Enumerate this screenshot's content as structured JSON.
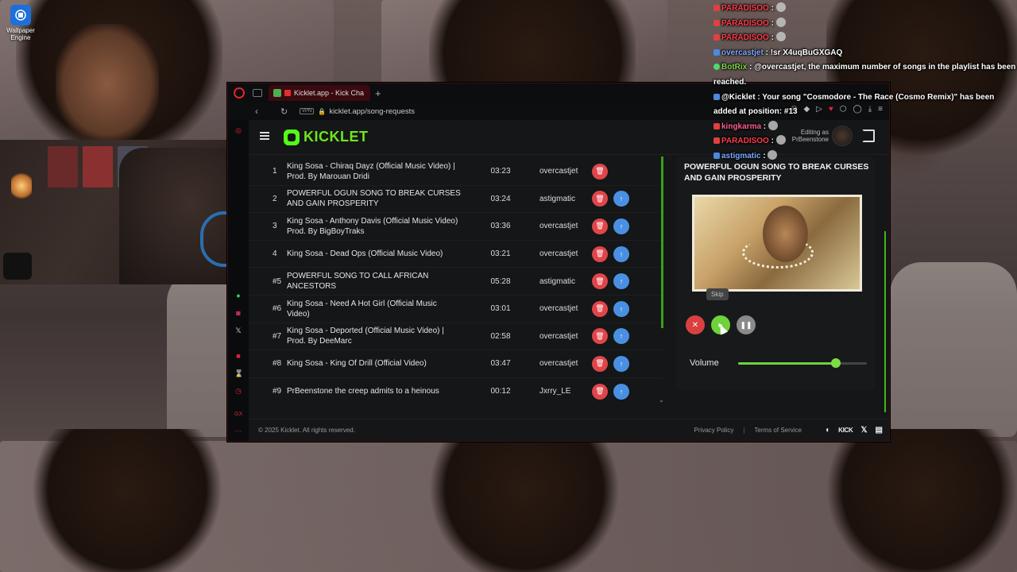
{
  "desktop": {
    "icon_label": "Wallpaper Engine"
  },
  "browser": {
    "tab_title": "Kicklet.app - Kick Cha",
    "vpn_badge": "VPN",
    "url": "kicklet.app/song-requests"
  },
  "app": {
    "logo_text": "KICKLET",
    "editing_as": "Editing as",
    "editing_user": "PrBeenstone"
  },
  "queue": [
    {
      "num": "1",
      "title": "King Sosa - Chiraq Dayz (Official Music Video) | Prod. By Marouan Dridi",
      "duration": "03:23",
      "user": "overcastjet",
      "can_move_up": false
    },
    {
      "num": "2",
      "title": "POWERFUL OGUN SONG TO BREAK CURSES AND GAIN PROSPERITY",
      "duration": "03:24",
      "user": "astigmatic",
      "can_move_up": true
    },
    {
      "num": "3",
      "title": "King Sosa - Anthony Davis (Official Music Video) Prod. By BigBoyTraks",
      "duration": "03:36",
      "user": "overcastjet",
      "can_move_up": true
    },
    {
      "num": "4",
      "title": "King Sosa - Dead Ops (Official Music Video)",
      "duration": "03:21",
      "user": "overcastjet",
      "can_move_up": true
    },
    {
      "num": "#5",
      "title": "POWERFUL SONG TO CALL AFRICAN ANCESTORS",
      "duration": "05:28",
      "user": "astigmatic",
      "can_move_up": true
    },
    {
      "num": "#6",
      "title": "King Sosa - Need A Hot Girl (Official Music Video)",
      "duration": "03:01",
      "user": "overcastjet",
      "can_move_up": true
    },
    {
      "num": "#7",
      "title": "King Sosa - Deported (Official Music Video) | Prod. By DeeMarc",
      "duration": "02:58",
      "user": "overcastjet",
      "can_move_up": true
    },
    {
      "num": "#8",
      "title": "King Sosa - King Of Drill (Official Video)",
      "duration": "03:47",
      "user": "overcastjet",
      "can_move_up": true
    },
    {
      "num": "#9",
      "title": "PrBeenstone the creep admits to a heinous",
      "duration": "00:12",
      "user": "Jxrry_LE",
      "can_move_up": true
    }
  ],
  "now_playing": {
    "title": "POWERFUL OGUN SONG TO BREAK CURSES AND GAIN PROSPERITY",
    "skip_tooltip": "Skip",
    "volume_label": "Volume",
    "volume_level": 0.76
  },
  "footer": {
    "copyright": "© 2025 Kicklet. All rights reserved.",
    "privacy": "Privacy Policy",
    "separator": "|",
    "terms": "Terms of Service",
    "kick_label": "KICK"
  },
  "chat": [
    {
      "name": "PARADISOO",
      "name_color": "red",
      "text": ""
    },
    {
      "name": "PARADISOO",
      "name_color": "red",
      "text": ""
    },
    {
      "name": "PARADISOO",
      "name_color": "red",
      "text": ""
    },
    {
      "name": "overcastjet",
      "name_color": "blue",
      "text": "!sr X4uqBuGXGAQ"
    },
    {
      "name": "BotRix",
      "name_color": "green",
      "text": "@overcastjet, the maximum number of songs in the playlist has been reached."
    },
    {
      "name": "@Kicklet",
      "name_color": "white",
      "text": "Your song \"Cosmodore - The Race (Cosmo Remix)\" has been added at position: #13"
    },
    {
      "name": "kingkarma",
      "name_color": "pink",
      "text": ""
    },
    {
      "name": "PARADISOO",
      "name_color": "red",
      "text": ""
    },
    {
      "name": "astigmatic",
      "name_color": "blue",
      "text": ""
    }
  ]
}
